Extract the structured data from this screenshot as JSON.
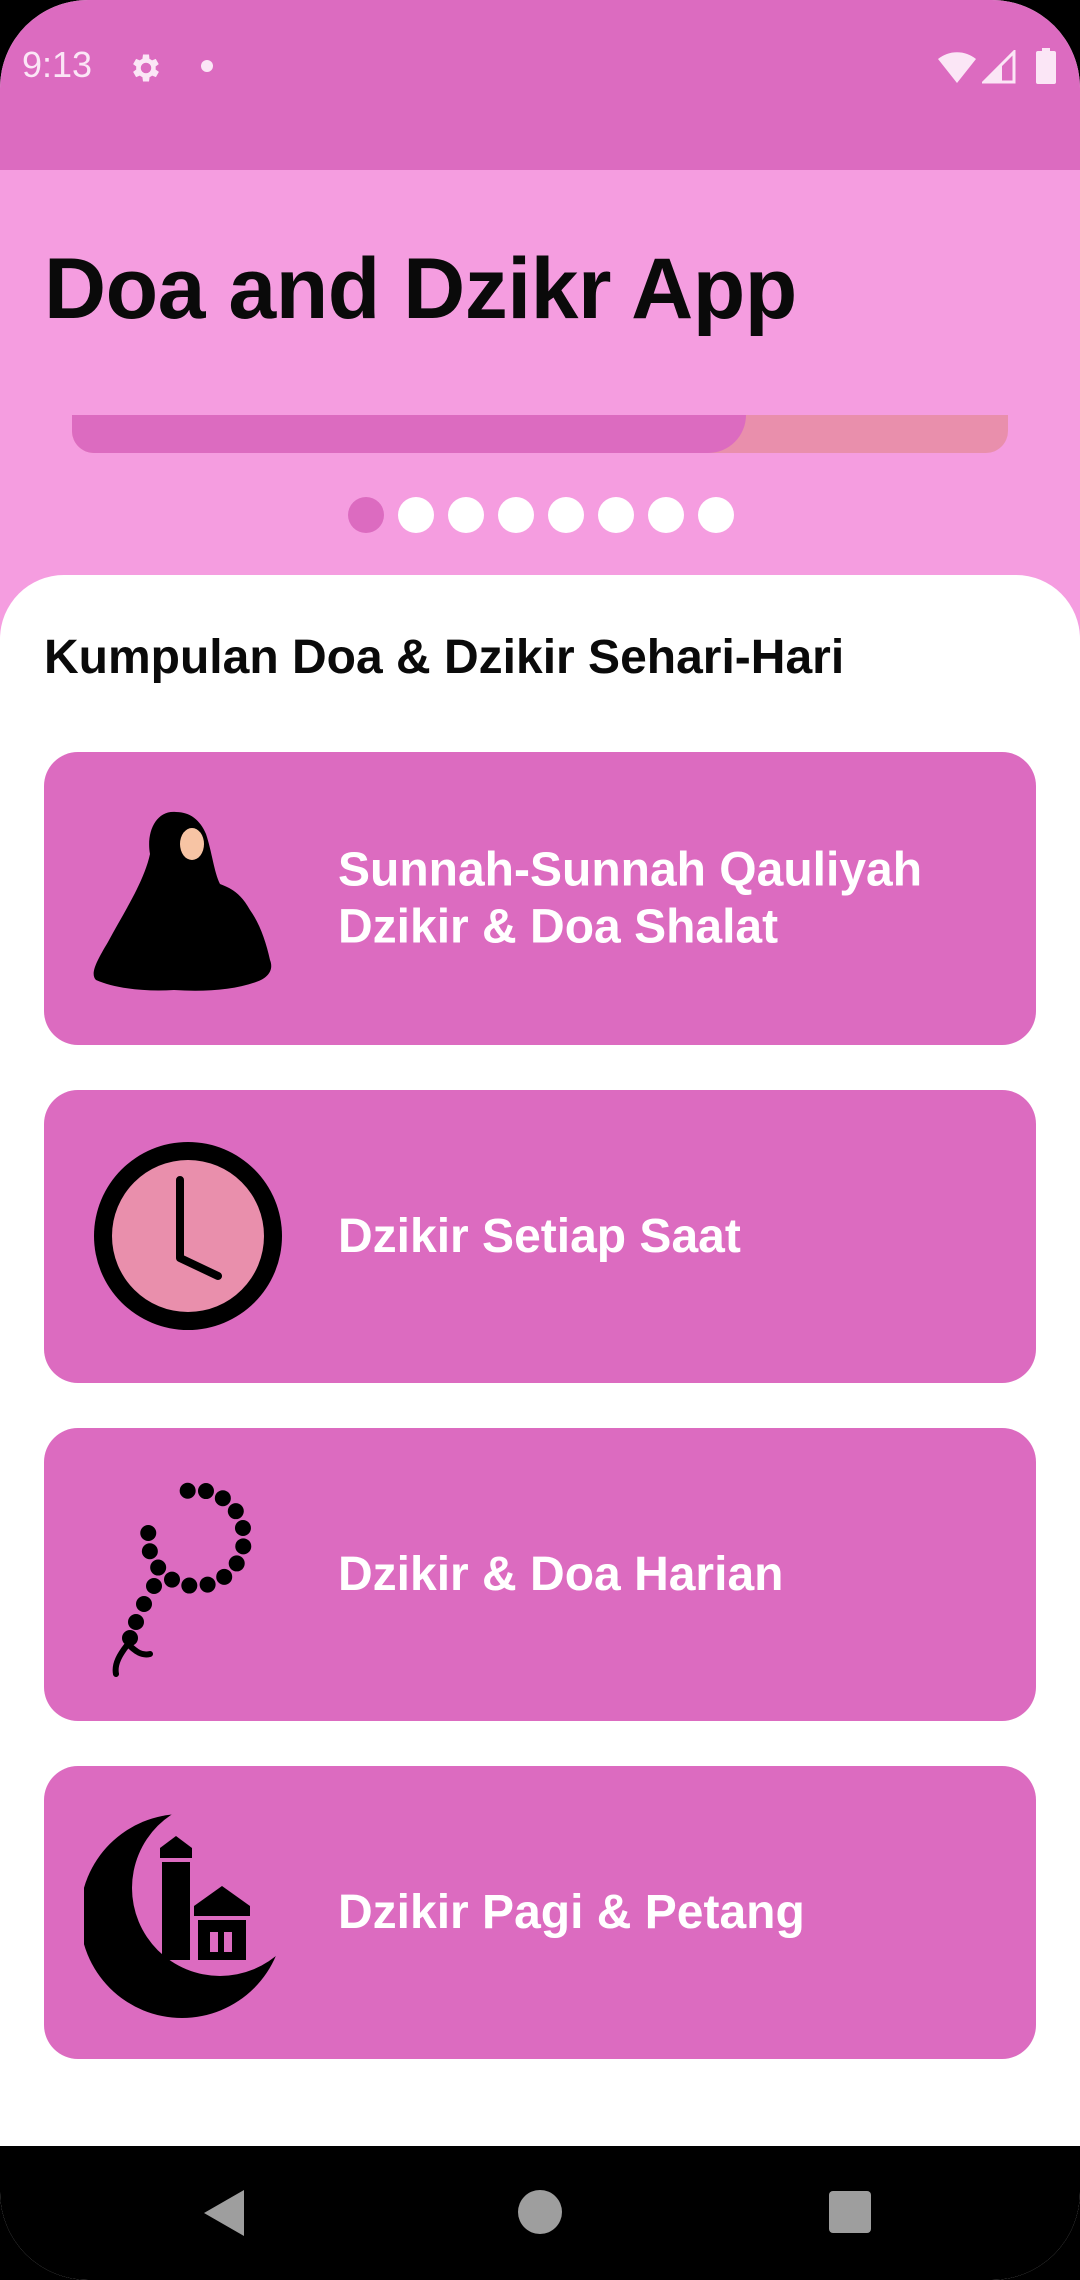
{
  "status_bar": {
    "time": "9:13",
    "icons": [
      "gear-icon",
      "notification-dot-icon",
      "wifi-icon",
      "signal-icon",
      "battery-icon"
    ]
  },
  "header": {
    "title": "Doa and Dzikr App",
    "carousel": {
      "progress": 0.72,
      "pages": 8,
      "active_page": 0
    }
  },
  "section_title": "Kumpulan Doa & Dzikir Sehari-Hari",
  "menu": [
    {
      "icon": "praying-woman-icon",
      "line1": "Sunnah-Sunnah Qauliyah",
      "line2": "Dzikir & Doa Shalat"
    },
    {
      "icon": "clock-icon",
      "line1": "Dzikir Setiap Saat",
      "line2": ""
    },
    {
      "icon": "prayer-beads-icon",
      "line1": "Dzikir & Doa Harian",
      "line2": ""
    },
    {
      "icon": "crescent-mosque-icon",
      "line1": "Dzikir Pagi & Petang",
      "line2": ""
    }
  ],
  "nav_bar": {
    "icons": [
      "back-icon",
      "home-icon",
      "recents-icon"
    ]
  },
  "colors": {
    "primary": "#dc6bc0",
    "header_bg": "#f59de0",
    "progress_track": "#e98fac",
    "clock_face": "#e98fac",
    "text_dark": "#0a0a0a",
    "text_light": "#ffffff"
  }
}
